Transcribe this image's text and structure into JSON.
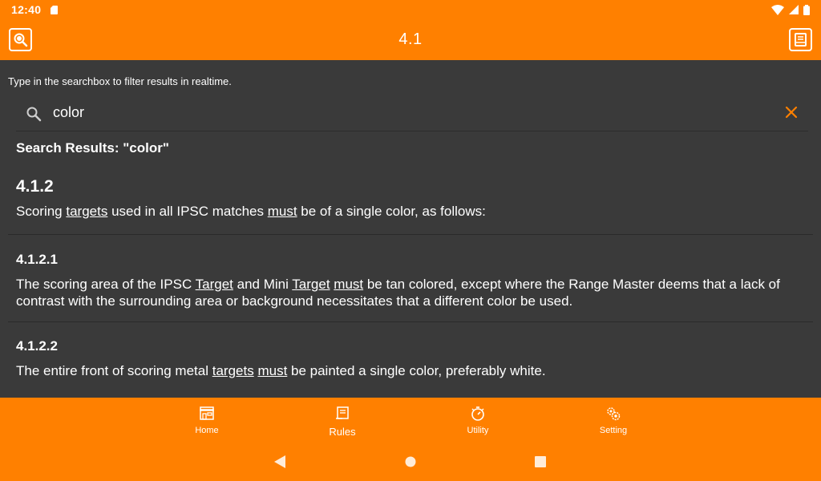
{
  "status": {
    "time": "12:40"
  },
  "appbar": {
    "title": "4.1",
    "left_icon": "search-doc-icon",
    "right_icon": "book-icon"
  },
  "search": {
    "hint": "Type in the searchbox to filter results in realtime.",
    "value": "color",
    "results_title": "Search Results: \"color\""
  },
  "rules": [
    {
      "number": "4.1.2",
      "parts": [
        "Scoring ",
        "targets",
        " used in all IPSC matches ",
        "must",
        " be of a single color, as follows:"
      ]
    },
    {
      "number": "4.1.2.1",
      "parts": [
        "The scoring area of the IPSC ",
        "Target",
        " and Mini ",
        "Target",
        " ",
        "must",
        " be tan colored, except where the Range Master deems that a lack of contrast with the surrounding area or background necessitates that a different color be used."
      ]
    },
    {
      "number": "4.1.2.2",
      "parts": [
        "The entire front of scoring metal ",
        "targets",
        " ",
        "must",
        " be painted a single color, preferably white."
      ]
    }
  ],
  "nav": {
    "home": "Home",
    "rules": "Rules",
    "utility": "Utility",
    "setting": "Setting"
  },
  "colors": {
    "accent": "#ff8000",
    "background": "#3a3a3a"
  }
}
